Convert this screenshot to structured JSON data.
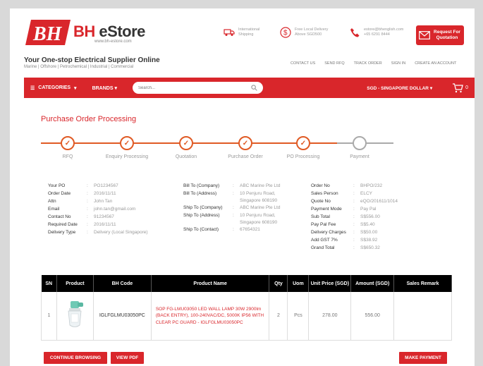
{
  "header": {
    "brand_name": "BH",
    "brand_store": "eStore",
    "brand_url": "www.bh-estore.com",
    "info": [
      {
        "icon": "truck-icon",
        "text": "International Shipping"
      },
      {
        "icon": "dollar-icon",
        "text": "Free Local Delivery Above SGD500"
      },
      {
        "icon": "phone-icon",
        "text": "estore@bhenglish.com +65 6291 8444"
      }
    ],
    "request_quote": "Request For Quotation",
    "tagline": "Your One-stop Electrical Supplier Online",
    "sub_tagline": "Marine | Offshore | Petrochemical | Industrial | Commercial",
    "top_links": [
      "CONTACT US",
      "SEND RFQ",
      "TRACK ORDER",
      "SIGN IN",
      "CREATE AN ACCOUNT"
    ]
  },
  "nav": {
    "categories": "CATEGORIES",
    "brands": "BRANDS",
    "search_placeholder": "Search...",
    "currency": "SGD - SINGAPORE DOLLAR",
    "cart_count": "0"
  },
  "page_title": "Purchase Order Processing",
  "steps": [
    {
      "label": "RFQ",
      "done": true
    },
    {
      "label": "Enquiry Processing",
      "done": true
    },
    {
      "label": "Quotation",
      "done": true
    },
    {
      "label": "Purchase Order",
      "done": true
    },
    {
      "label": "PO Processing",
      "done": true
    },
    {
      "label": "Payment",
      "done": false
    }
  ],
  "info_left": [
    {
      "k": "Your PO",
      "v": "PO1234567"
    },
    {
      "k": "Order Date",
      "v": "2016/11/11"
    },
    {
      "k": "Attn",
      "v": "John Tan"
    },
    {
      "k": "Email",
      "v": "john.tan@gmail.com"
    },
    {
      "k": "Contact No",
      "v": "91234567"
    },
    {
      "k": "Required Date",
      "v": "2016/11/11"
    },
    {
      "k": "Delivery Type",
      "v": "Delivery (Local Singapore)"
    }
  ],
  "info_mid": [
    {
      "k": "Bill To (Company)",
      "v": "ABC Marine Pte Ltd"
    },
    {
      "k": "Bill To (Address)",
      "v": "10 Penjuru Road,",
      "v2": "Singapore 608190"
    },
    {
      "k": "Ship To (Company)",
      "v": "ABC Marine Pte Ltd"
    },
    {
      "k": "Ship To (Address)",
      "v": "10 Penjuru Road,",
      "v2": "Singapore 608190"
    },
    {
      "k": "Ship To (Contact)",
      "v": "67654321"
    }
  ],
  "info_right": [
    {
      "k": "Order No",
      "v": "BHPO/232"
    },
    {
      "k": "Sales Person",
      "v": "ELCY"
    },
    {
      "k": "Quote No",
      "v": "eQO/201611/1014"
    },
    {
      "k": "Payment Mode",
      "v": "Pay Pal"
    },
    {
      "k": "Sub Total",
      "v": "S$556.00"
    },
    {
      "k": "Pay Pal Fee",
      "v": "S$5.40"
    },
    {
      "k": "Delivery Charges",
      "v": "S$50.00"
    },
    {
      "k": "Add GST 7%",
      "v": "S$38.92"
    },
    {
      "k": "Grand Total",
      "v": "S$650.32"
    }
  ],
  "table": {
    "headers": [
      "SN",
      "Product",
      "BH Code",
      "Product Name",
      "Qty",
      "Uom",
      "Unit Price (SGD)",
      "Amount (SGD)",
      "Sales Remark"
    ],
    "rows": [
      {
        "sn": "1",
        "code": "IGLFGLMU03050PC",
        "name": "SOP FG-LMU03050 LED WALL LAMP 30W 2900lm (BACK ENTRY), 100-240VAC/DC, 5000K IP56 WITH CLEAR PC GUARD - IGLFGLMU03050PC",
        "qty": "2",
        "uom": "Pcs",
        "unit_price": "278.00",
        "amount": "556.00",
        "remark": ""
      }
    ]
  },
  "buttons": {
    "continue": "CONTINUE BROWSING",
    "view_pdf": "VIEW PDF",
    "make_payment": "MAKE PAYMENT"
  },
  "colors": {
    "accent": "#d9262b",
    "step": "#e05a24",
    "step_inactive": "#aaaaaa"
  }
}
